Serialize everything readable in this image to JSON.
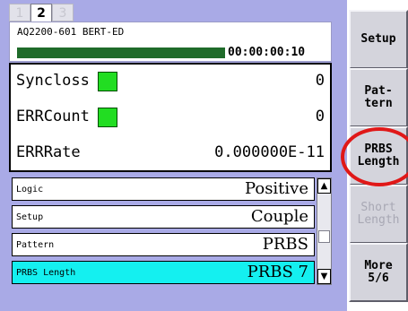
{
  "page_tabs": [
    "1",
    "2",
    "3"
  ],
  "active_tab": "2",
  "header": {
    "instrument": "AQ2200-601 BERT-ED",
    "elapsed_time": "00:00:00:10"
  },
  "measurements": [
    {
      "label": "Syncloss",
      "value": "0",
      "indicator": true
    },
    {
      "label": "ERRCount",
      "value": "0",
      "indicator": true
    },
    {
      "label": "ERRRate",
      "value": "0.000000E-11",
      "indicator": false
    }
  ],
  "settings": [
    {
      "label": "Logic",
      "value": "Positive"
    },
    {
      "label": "Setup",
      "value": "Couple"
    },
    {
      "label": "Pattern",
      "value": "PRBS"
    },
    {
      "label": "PRBS Length",
      "value": "PRBS 7"
    }
  ],
  "selected_setting": "PRBS Length",
  "softkeys": [
    {
      "label": "Setup",
      "enabled": true
    },
    {
      "label": "Pat-\ntern",
      "enabled": true
    },
    {
      "label": "PRBS\nLength",
      "enabled": true
    },
    {
      "label": "Short\nLength",
      "enabled": false
    },
    {
      "label": "More\n5/6",
      "enabled": true
    }
  ],
  "colors": {
    "panel": "#a9aae6",
    "indicator_ok": "#22dd22",
    "elapsed_bar": "#1f6b2a",
    "selected_row": "#14f0f0",
    "highlight": "#e01818"
  },
  "icons": {
    "scroll_up": "▲",
    "scroll_down": "▼"
  }
}
